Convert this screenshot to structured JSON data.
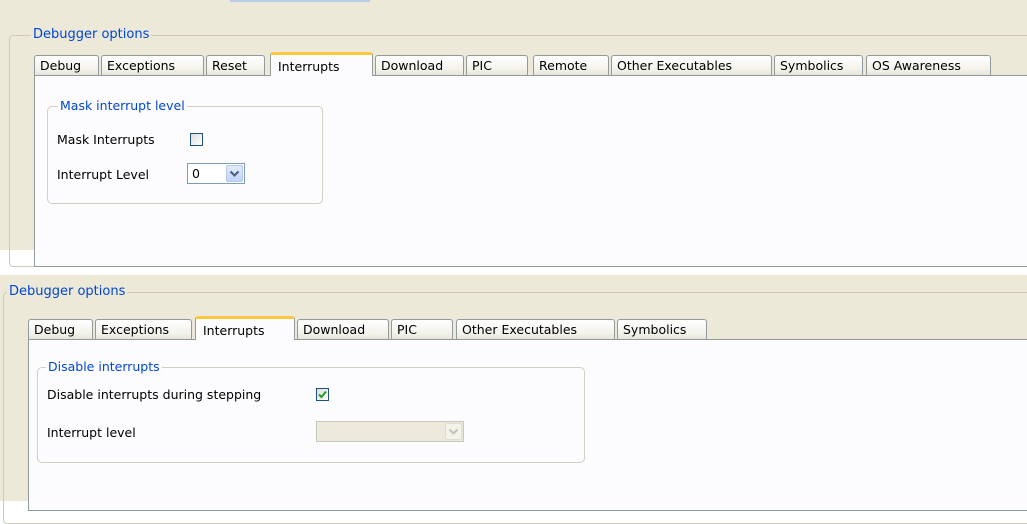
{
  "panel1": {
    "group_label": "Debugger options",
    "tabs": [
      "Debug",
      "Exceptions",
      "Reset",
      "Interrupts",
      "Download",
      "PIC",
      "Remote",
      "Other Executables",
      "Symbolics",
      "OS Awareness"
    ],
    "active_tab": "Interrupts",
    "section_label": "Mask interrupt level",
    "mask_interrupts_label": "Mask Interrupts",
    "mask_interrupts_checked": false,
    "interrupt_level_label": "Interrupt Level",
    "interrupt_level_value": "0"
  },
  "panel2": {
    "group_label": "Debugger options",
    "tabs": [
      "Debug",
      "Exceptions",
      "Interrupts",
      "Download",
      "PIC",
      "Other Executables",
      "Symbolics"
    ],
    "active_tab": "Interrupts",
    "section_label": "Disable interrupts",
    "disable_stepping_label": "Disable interrupts during stepping",
    "disable_stepping_checked": true,
    "interrupt_level_label": "Interrupt level",
    "interrupt_level_value": ""
  },
  "colors": {
    "legend_blue": "#0046d5",
    "active_tab_accent": "#ffc83c",
    "check_green": "#21a121",
    "dropdown_arrow": "#4d6185"
  }
}
